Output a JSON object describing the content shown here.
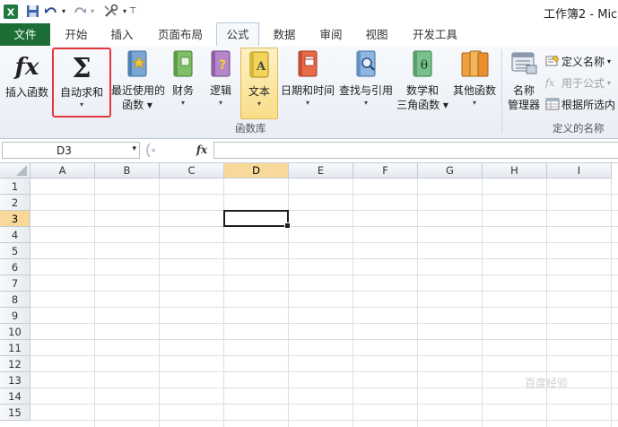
{
  "title_bar": {
    "title": "工作簿2 - Mic"
  },
  "tabs": [
    {
      "label": "文件"
    },
    {
      "label": "开始"
    },
    {
      "label": "插入"
    },
    {
      "label": "页面布局"
    },
    {
      "label": "公式"
    },
    {
      "label": "数据"
    },
    {
      "label": "审阅"
    },
    {
      "label": "视图"
    },
    {
      "label": "开发工具"
    }
  ],
  "ribbon": {
    "insert_function": "插入函数",
    "autosum": "自动求和",
    "recent_line1": "最近使用的",
    "recent_line2": "函数",
    "financial": "财务",
    "logical": "逻辑",
    "text": "文本",
    "datetime": "日期和时间",
    "lookup": "查找与引用",
    "math_line1": "数学和",
    "math_line2": "三角函数",
    "more": "其他函数",
    "group_library": "函数库",
    "name_manager_line1": "名称",
    "name_manager_line2": "管理器",
    "define_name": "定义名称",
    "use_in_formula": "用于公式",
    "create_from_selection": "根据所选内",
    "group_defined_names": "定义的名称"
  },
  "formula_bar": {
    "name_box": "D3",
    "fx": "fx",
    "value": ""
  },
  "grid": {
    "columns": [
      "A",
      "B",
      "C",
      "D",
      "E",
      "F",
      "G",
      "H",
      "I"
    ],
    "rows": [
      "1",
      "2",
      "3",
      "4",
      "5",
      "6",
      "7",
      "8",
      "9",
      "10",
      "11",
      "12",
      "13",
      "14",
      "15"
    ],
    "selected_cell": "D3"
  },
  "watermark": "百度经验"
}
